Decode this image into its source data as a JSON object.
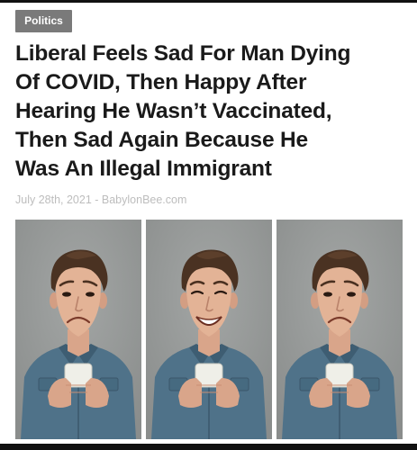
{
  "article": {
    "category": "Politics",
    "headline_lines": [
      "Liberal Feels Sad For Man Dying",
      "Of COVID, Then Happy After",
      "Hearing He Wasn’t Vaccinated,",
      "Then Sad Again Because He",
      "Was An Illegal Immigrant"
    ],
    "byline": "July 28th, 2021 - BabylonBee.com"
  },
  "photos": [
    {
      "expression": "sad"
    },
    {
      "expression": "happy"
    },
    {
      "expression": "sad"
    }
  ],
  "colors": {
    "badge": "#7a7a7a",
    "headline": "#1a1a1a",
    "byline": "#bdbdbd",
    "photo_background": "#8a8d8c",
    "shirt": "#4f7289"
  }
}
